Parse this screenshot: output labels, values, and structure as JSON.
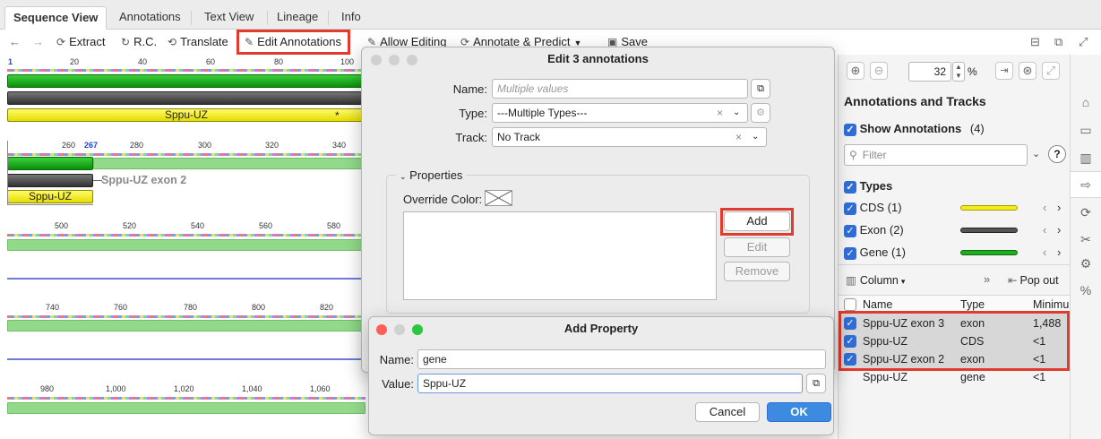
{
  "tabs": [
    {
      "label": "Sequence View",
      "active": true
    },
    {
      "label": "Annotations"
    },
    {
      "label": "Text View"
    },
    {
      "label": "Lineage"
    },
    {
      "label": "Info"
    }
  ],
  "toolbar": {
    "extract": "Extract",
    "rc": "R.C.",
    "translate": "Translate",
    "edit_annotations": "Edit Annotations",
    "allow_editing": "Allow Editing",
    "annotate_predict": "Annotate & Predict",
    "save": "Save"
  },
  "sequence": {
    "ruler1": [
      "1",
      "20",
      "40",
      "60",
      "80",
      "100"
    ],
    "ruler2": [
      "260",
      "267",
      "280",
      "300",
      "320",
      "340"
    ],
    "ruler3": [
      "500",
      "520",
      "540",
      "560",
      "580"
    ],
    "ruler4": [
      "740",
      "760",
      "780",
      "800",
      "820"
    ],
    "ruler5": [
      "980",
      "1,000",
      "1,020",
      "1,040",
      "1,060"
    ],
    "cds_label": "Sppu-UZ",
    "exon2_label": "Sppu-UZ exon 2",
    "cds_label_2": "Sppu-UZ"
  },
  "zoom": {
    "value": "32",
    "unit": "%"
  },
  "panel": {
    "title": "Annotations and Tracks",
    "show_annotations": "Show Annotations",
    "count": "(4)",
    "filter_placeholder": "Filter",
    "types_label": "Types",
    "types": [
      {
        "label": "CDS (1)",
        "color": "#f3ec1a"
      },
      {
        "label": "Exon (2)",
        "color": "#555555"
      },
      {
        "label": "Gene (1)",
        "color": "#1fae1f"
      }
    ],
    "column_label": "Column",
    "pop_out": "Pop out",
    "headers": [
      "Name",
      "Type",
      "Minimu"
    ],
    "rows": [
      {
        "name": "Sppu-UZ exon 3",
        "type": "exon",
        "min": "1,488",
        "checked": true
      },
      {
        "name": "Sppu-UZ",
        "type": "CDS",
        "min": "<1",
        "checked": true
      },
      {
        "name": "Sppu-UZ exon 2",
        "type": "exon",
        "min": "<1",
        "checked": true
      },
      {
        "name": "Sppu-UZ",
        "type": "gene",
        "min": "<1",
        "checked": false
      }
    ]
  },
  "edit_dialog": {
    "title": "Edit 3 annotations",
    "name_label": "Name:",
    "name_placeholder": "Multiple values",
    "type_label": "Type:",
    "type_value": "---Multiple Types---",
    "track_label": "Track:",
    "track_value": "No Track",
    "properties_label": "Properties",
    "override_color_label": "Override Color:",
    "add_label": "Add",
    "edit_label": "Edit",
    "remove_label": "Remove"
  },
  "add_property_dialog": {
    "title": "Add Property",
    "name_label": "Name:",
    "name_value": "gene",
    "value_label": "Value:",
    "value_value": "Sppu-UZ",
    "cancel_label": "Cancel",
    "ok_label": "OK"
  },
  "colors": {
    "accent": "#2f6ed8",
    "highlight": "#e23b2e"
  }
}
